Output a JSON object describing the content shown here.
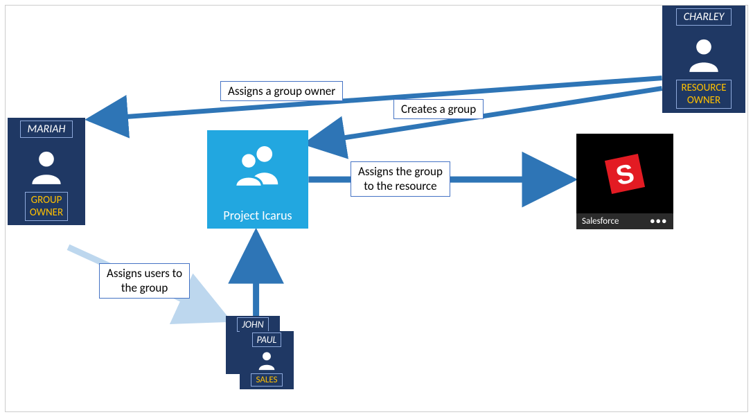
{
  "actors": {
    "charley": {
      "name": "CHARLEY",
      "role": "RESOURCE<br>OWNER",
      "role_lines": [
        "RESOURCE",
        "OWNER"
      ]
    },
    "mariah": {
      "name": "MARIAH",
      "role": "GROUP OWNER",
      "role_lines": [
        "GROUP",
        "OWNER"
      ]
    },
    "john": {
      "name": "JOHN",
      "role": "SALES"
    },
    "paul": {
      "name": "PAUL",
      "role": "SALES"
    }
  },
  "group": {
    "name": "Project Icarus"
  },
  "resource": {
    "name": "Salesforce"
  },
  "labels": {
    "assign_owner": "Assigns a group owner",
    "create_group": "Creates a group",
    "assign_resource": "Assigns the group\nto the resource",
    "assign_resource_l1": "Assigns the group",
    "assign_resource_l2": "to the resource",
    "assign_users": "Assigns users to\nthe group",
    "assign_users_l1": "Assigns users to",
    "assign_users_l2": "the group"
  },
  "colors": {
    "card_bg": "#1f3864",
    "accent_yellow": "#ffc000",
    "group_bg": "#22a7e0",
    "arrow": "#2e75b6",
    "arrow_light": "#bdd7ee"
  }
}
